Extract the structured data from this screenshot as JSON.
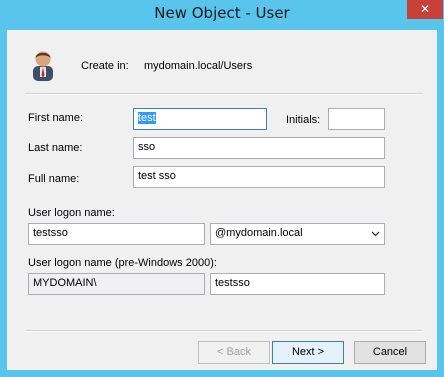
{
  "window": {
    "title": "New Object - User",
    "close_glyph": "✕"
  },
  "header": {
    "icon": "user-icon",
    "create_in_label": "Create in:",
    "create_in_value": "mydomain.local/Users"
  },
  "form": {
    "first_name_label": "First name:",
    "first_name_value": "test",
    "initials_label": "Initials:",
    "initials_value": "",
    "last_name_label": "Last name:",
    "last_name_value": "sso",
    "full_name_label": "Full name:",
    "full_name_value": "test sso",
    "logon_name_label": "User logon name:",
    "logon_name_value": "testsso",
    "upn_suffix_value": "@mydomain.local",
    "pre2000_label": "User logon name (pre-Windows 2000):",
    "pre2000_domain_value": "MYDOMAIN\\",
    "pre2000_name_value": "testsso"
  },
  "buttons": {
    "back": "< Back",
    "next": "Next >",
    "cancel": "Cancel"
  },
  "colors": {
    "frame": "#59c4ec",
    "close_button": "#c7403a",
    "client": "#f0f0f0",
    "selection": "#3399ff"
  }
}
